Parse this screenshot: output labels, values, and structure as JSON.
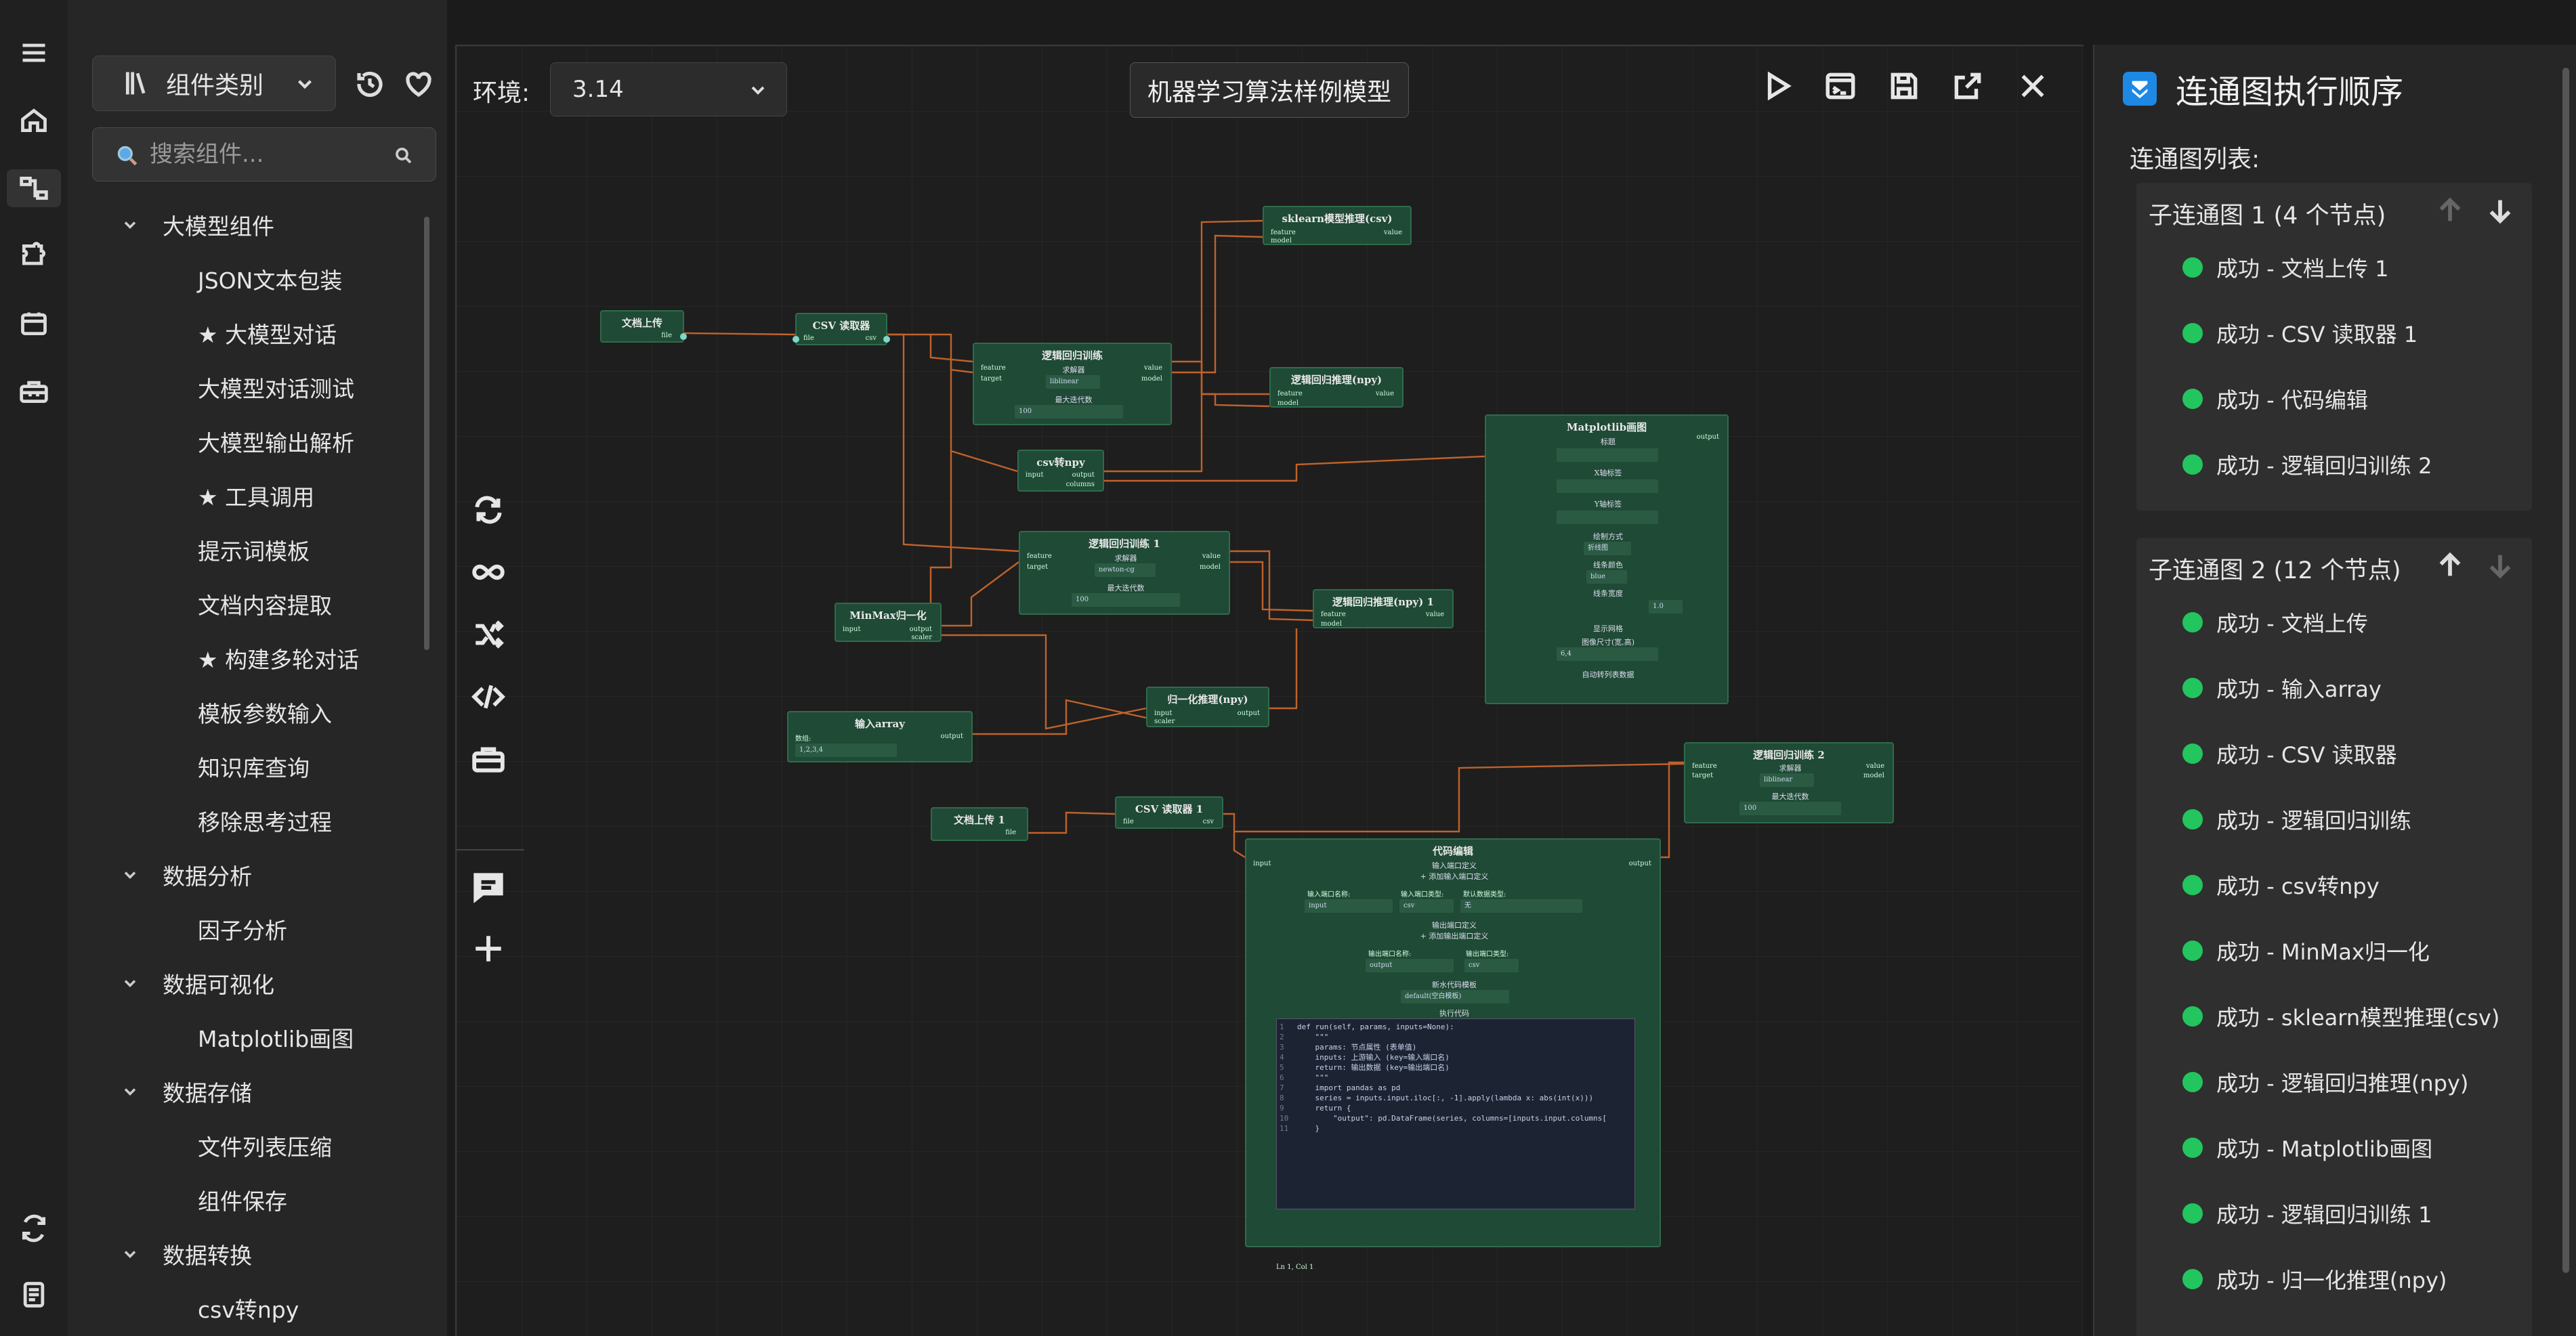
{
  "sidebar": {
    "category_button": "组件类别",
    "search_placeholder": "搜索组件...",
    "tree": [
      {
        "type": "cat",
        "label": "大模型组件"
      },
      {
        "type": "item",
        "label": "JSON文本包装"
      },
      {
        "type": "item",
        "label": "★ 大模型对话"
      },
      {
        "type": "item",
        "label": "大模型对话测试"
      },
      {
        "type": "item",
        "label": "大模型输出解析"
      },
      {
        "type": "item",
        "label": "★ 工具调用"
      },
      {
        "type": "item",
        "label": "提示词模板"
      },
      {
        "type": "item",
        "label": "文档内容提取"
      },
      {
        "type": "item",
        "label": "★ 构建多轮对话"
      },
      {
        "type": "item",
        "label": "模板参数输入"
      },
      {
        "type": "item",
        "label": "知识库查询"
      },
      {
        "type": "item",
        "label": "移除思考过程"
      },
      {
        "type": "cat",
        "label": "数据分析"
      },
      {
        "type": "item",
        "label": "因子分析"
      },
      {
        "type": "cat",
        "label": "数据可视化"
      },
      {
        "type": "item",
        "label": "Matplotlib画图"
      },
      {
        "type": "cat",
        "label": "数据存储"
      },
      {
        "type": "item",
        "label": "文件列表压缩"
      },
      {
        "type": "item",
        "label": "组件保存"
      },
      {
        "type": "cat",
        "label": "数据转换"
      },
      {
        "type": "item",
        "label": "csv转npy"
      }
    ]
  },
  "editor": {
    "env_label": "环境:",
    "env_value": "3.14",
    "title": "机器学习算法样例模型"
  },
  "nodes": {
    "doc_upload": "文档上传",
    "csv_reader": "CSV 读取器",
    "lr_train": "逻辑回归训练",
    "lr_train_1": "逻辑回归训练 1",
    "lr_train_2": "逻辑回归训练 2",
    "sklearn_infer": "sklearn模型推理(csv)",
    "lr_infer_npy": "逻辑回归推理(npy)",
    "lr_infer_npy_1": "逻辑回归推理(npy) 1",
    "csv_to_npy": "csv转npy",
    "minmax": "MinMax归一化",
    "input_array": "输入array",
    "norm_infer": "归一化推理(npy)",
    "doc_upload_1": "文档上传 1",
    "csv_reader_1": "CSV 读取器 1",
    "matplotlib": "Matplotlib画图",
    "code_edit": "代码编辑",
    "port_feature": "feature",
    "port_target": "target",
    "port_value": "value",
    "port_model": "model",
    "port_csv": "csv",
    "port_file": "file",
    "port_input": "input",
    "port_output": "output",
    "port_scaler": "scaler",
    "port_columns": "columns",
    "solver_label": "求解器",
    "solver_liblinear": "liblinear",
    "solver_newton": "newton-cg",
    "max_iter_label": "最大迭代数",
    "max_iter_value": "100",
    "input_value_label": "数组:",
    "input_value": "1,2,3,4",
    "mpl_title": "标题",
    "mpl_xlabel": "X轴标签",
    "mpl_ylabel": "Y轴标签",
    "mpl_style": "绘制方式",
    "mpl_style_val": "折线图",
    "mpl_color": "线条颜色",
    "mpl_color_val": "blue",
    "mpl_width": "线条宽度",
    "mpl_width_val": "1.0",
    "mpl_grid": "显示网格",
    "mpl_size": "图像尺寸(宽,高)",
    "mpl_size_val": "6,4",
    "mpl_auto": "自动转列表数据",
    "code_in_def": "输入端口定义",
    "code_add_in": "+ 添加输入端口定义",
    "code_in_name": "输入端口名称:",
    "code_in_type": "输入端口类型:",
    "code_in_default": "默认数据类型:",
    "code_in_name_val": "input",
    "code_in_type_val": "csv",
    "code_in_default_val": "无",
    "code_out_def": "输出端口定义",
    "code_add_out": "+ 添加输出端口定义",
    "code_out_name": "输出端口名称:",
    "code_out_type": "输出端口类型:",
    "code_out_name_val": "output",
    "code_out_type_val": "csv",
    "code_template": "新水代码模板",
    "code_template_val": "default(空白模板)",
    "code_exec": "执行代码",
    "code_status": "Ln 1, Col 1"
  },
  "code_lines": [
    "def run(self, params, inputs=None):",
    "    \"\"\"",
    "    params: 节点属性 (表单值)",
    "    inputs: 上游输入 (key=输入端口名)",
    "    return: 输出数据 (key=输出端口名)",
    "    \"\"\"",
    "    import pandas as pd",
    "    series = inputs.input.iloc[:, -1].apply(lambda x: abs(int(x)))",
    "    return {",
    "        \"output\": pd.DataFrame(series, columns=[inputs.input.columns[",
    "    }"
  ],
  "rpanel": {
    "title": "连通图执行顺序",
    "list_label": "连通图列表:",
    "groups": [
      {
        "header": "子连通图 1 (4 个节点)",
        "steps": [
          "成功 - 文档上传 1",
          "成功 - CSV 读取器 1",
          "成功 - 代码编辑",
          "成功 - 逻辑回归训练 2"
        ]
      },
      {
        "header": "子连通图 2 (12 个节点)",
        "steps": [
          "成功 - 文档上传",
          "成功 - 输入array",
          "成功 - CSV 读取器",
          "成功 - 逻辑回归训练",
          "成功 - csv转npy",
          "成功 - MinMax归一化",
          "成功 - sklearn模型推理(csv)",
          "成功 - 逻辑回归推理(npy)",
          "成功 - Matplotlib画图",
          "成功 - 逻辑回归训练 1",
          "成功 - 归一化推理(npy)"
        ]
      }
    ]
  },
  "colors": {
    "node_bg": "#1f4a35",
    "edge": "#c0622a",
    "success": "#22c55e",
    "accent": "#1e88e5"
  }
}
